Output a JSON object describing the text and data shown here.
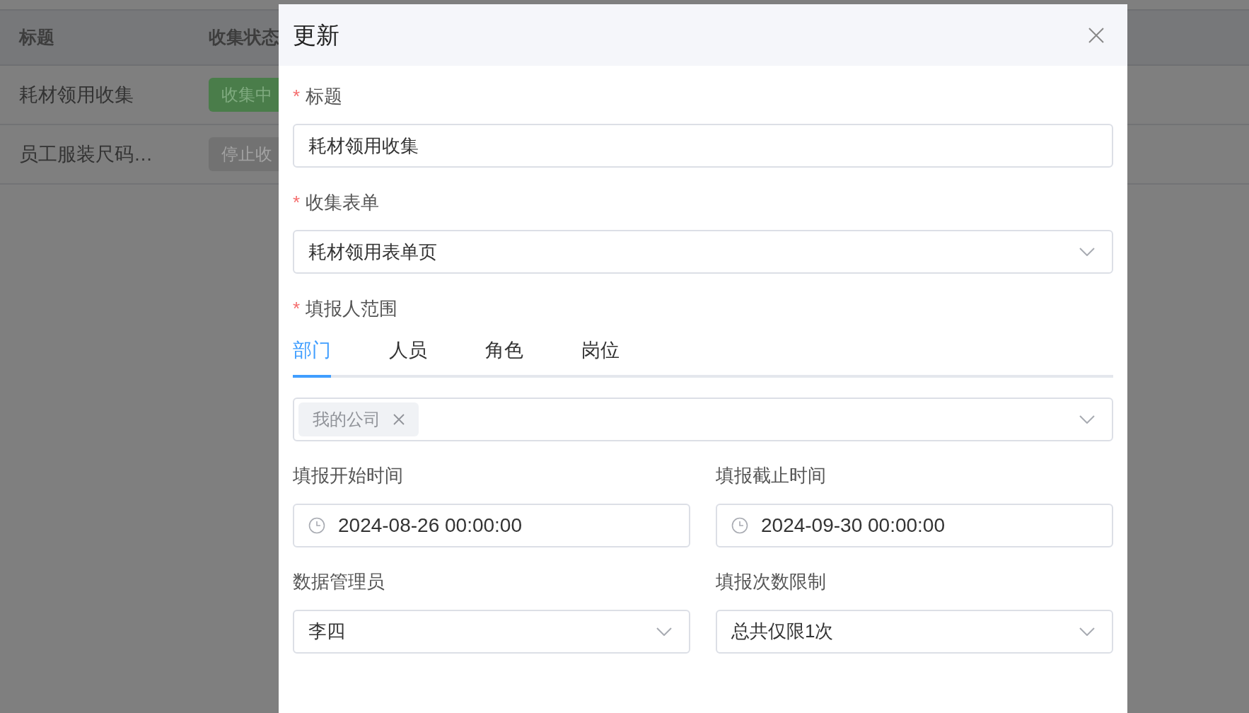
{
  "table": {
    "columns": [
      "标题",
      "收集状态"
    ],
    "rows": [
      {
        "title": "耗材领用收集",
        "status": {
          "label": "收集中",
          "kind": "active"
        }
      },
      {
        "title": "员工服装尺码…",
        "status": {
          "label": "停止收",
          "kind": "stopped"
        }
      }
    ]
  },
  "dialog": {
    "title": "更新",
    "fields": [
      {
        "kind": "text",
        "label": "标题",
        "marker": "*",
        "value": "耗材领用收集"
      },
      {
        "kind": "select",
        "label": "收集表单",
        "marker": "*",
        "value": "耗材领用表单页"
      },
      {
        "kind": "scope",
        "label": "填报人范围",
        "marker": "*",
        "tabs": [
          {
            "label": "部门",
            "selected": true
          },
          {
            "label": "人员",
            "selected": false
          },
          {
            "label": "角色",
            "selected": false
          },
          {
            "label": "岗位",
            "selected": false
          }
        ],
        "tags": [
          {
            "label": "我的公司"
          }
        ]
      },
      {
        "kind": "pair",
        "items": [
          {
            "kind": "datetime",
            "label": "填报开始时间",
            "value": "2024-08-26 00:00:00"
          },
          {
            "kind": "datetime",
            "label": "填报截止时间",
            "value": "2024-09-30 00:00:00"
          }
        ]
      },
      {
        "kind": "pair",
        "items": [
          {
            "kind": "select",
            "label": "数据管理员",
            "value": "李四"
          },
          {
            "kind": "select",
            "label": "填报次数限制",
            "value": "总共仅限1次"
          }
        ]
      }
    ]
  }
}
